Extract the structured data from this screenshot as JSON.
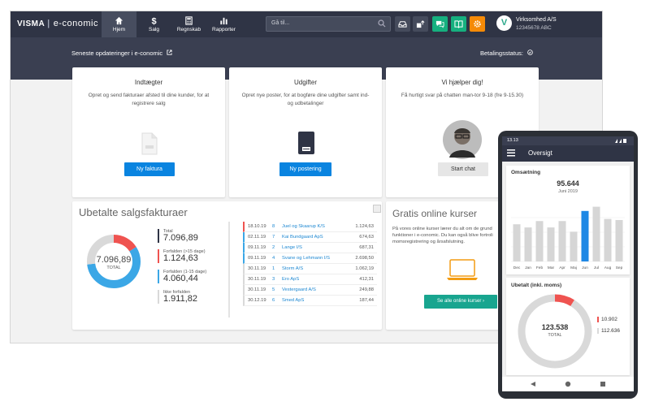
{
  "app": {
    "brand": "VISMA",
    "product": "e-conomic",
    "nav": [
      {
        "label": "Hjem",
        "icon": "home-icon",
        "active": true
      },
      {
        "label": "Salg",
        "icon": "dollar-icon"
      },
      {
        "label": "Regnskab",
        "icon": "calculator-icon"
      },
      {
        "label": "Rapporter",
        "icon": "bar-chart-icon"
      }
    ],
    "search_placeholder": "Gå til...",
    "company_initial": "V",
    "company_name": "Virksomhed A/S",
    "company_id": "12345678 ABC"
  },
  "subbar": {
    "updates": "Seneste opdateringer i e-conomic",
    "payment": "Betalingsstatus:"
  },
  "cards": {
    "income": {
      "title": "Indtægter",
      "desc": "Opret og send fakturaer afsted til dine kunder, for at registrere salg",
      "button": "Ny faktura"
    },
    "expenses": {
      "title": "Udgifter",
      "desc": "Opret nye poster, for at bogføre dine udgifter samt ind- og udbetalinger",
      "button": "Ny postering"
    },
    "help": {
      "title": "Vi hjælper dig!",
      "desc": "Få hurtigt svar på chatten man-tor 9-18 (fre 9-15.30)",
      "button": "Start chat"
    }
  },
  "unpaid": {
    "title": "Ubetalte salgsfakturaer",
    "total_value": "7.096,89",
    "total_label": "TOTAL",
    "legend": [
      {
        "label": "Total",
        "value": "7.096,89",
        "color": "#2f3445"
      },
      {
        "label": "Forfalden (>15 dage)",
        "value": "1.124,63",
        "color": "#ef5350"
      },
      {
        "label": "Forfalden (1-15 dage)",
        "value": "4.060,44",
        "color": "#3ba7e6"
      },
      {
        "label": "Ikke forfalden",
        "value": "1.911,82",
        "color": "#d9d9d9"
      }
    ],
    "donut": {
      "overdue15": 1124.63,
      "overdue1_15": 4060.44,
      "notdue": 1911.82
    },
    "rows": [
      {
        "date": "18.10.19",
        "no": "8",
        "name": "Juel og Skaarup K/S",
        "amount": "1.124,63",
        "flag": "#ef5350"
      },
      {
        "date": "02.11.19",
        "no": "7",
        "name": "Kai Bundgaard ApS",
        "amount": "674,63",
        "flag": "#3ba7e6"
      },
      {
        "date": "09.11.19",
        "no": "2",
        "name": "Lange I/S",
        "amount": "687,31",
        "flag": "#3ba7e6"
      },
      {
        "date": "09.11.19",
        "no": "4",
        "name": "Svane og Lehmann I/S",
        "amount": "2.698,50",
        "flag": "#3ba7e6"
      },
      {
        "date": "30.11.19",
        "no": "1",
        "name": "Storm A/S",
        "amount": "1.062,19",
        "flag": "#d9d9d9"
      },
      {
        "date": "30.11.19",
        "no": "3",
        "name": "Ero ApS",
        "amount": "412,31",
        "flag": "#d9d9d9"
      },
      {
        "date": "30.11.19",
        "no": "5",
        "name": "Vestergaard A/S",
        "amount": "249,88",
        "flag": "#d9d9d9"
      },
      {
        "date": "30.12.19",
        "no": "6",
        "name": "Smed ApS",
        "amount": "187,44",
        "flag": "#d9d9d9"
      }
    ]
  },
  "courses": {
    "title": "Gratis online kurser",
    "desc": "På vores online kurser lærer du alt om de grund funktioner i e-conomic. Du kan også blive fortroli momsregistrering og årsafslutning.",
    "button": "Se alle online kurser"
  },
  "phone": {
    "time": "13.13",
    "title": "Oversigt",
    "revenue_title": "Omsætning",
    "revenue_value": "95.644",
    "revenue_period": "Juni 2019",
    "paid_title": "Ubetalt (inkl. moms)",
    "paid_value": "123.538",
    "paid_label": "TOTAL",
    "paid_legend": [
      {
        "value": "10.902",
        "color": "#ef5350"
      },
      {
        "value": "112.636",
        "color": "#d9d9d9"
      }
    ]
  },
  "chart_data": {
    "type": "bar",
    "categories": [
      "Dec",
      "Jan",
      "Feb",
      "Mar",
      "Apr",
      "Maj",
      "Jun",
      "Jul",
      "Aug",
      "Sep"
    ],
    "values": [
      70,
      64,
      76,
      64,
      76,
      56,
      95,
      103,
      80,
      78
    ],
    "highlight": "Jun",
    "colors": {
      "bar": "#d6d6d6",
      "highlight": "#1e88e5"
    }
  }
}
